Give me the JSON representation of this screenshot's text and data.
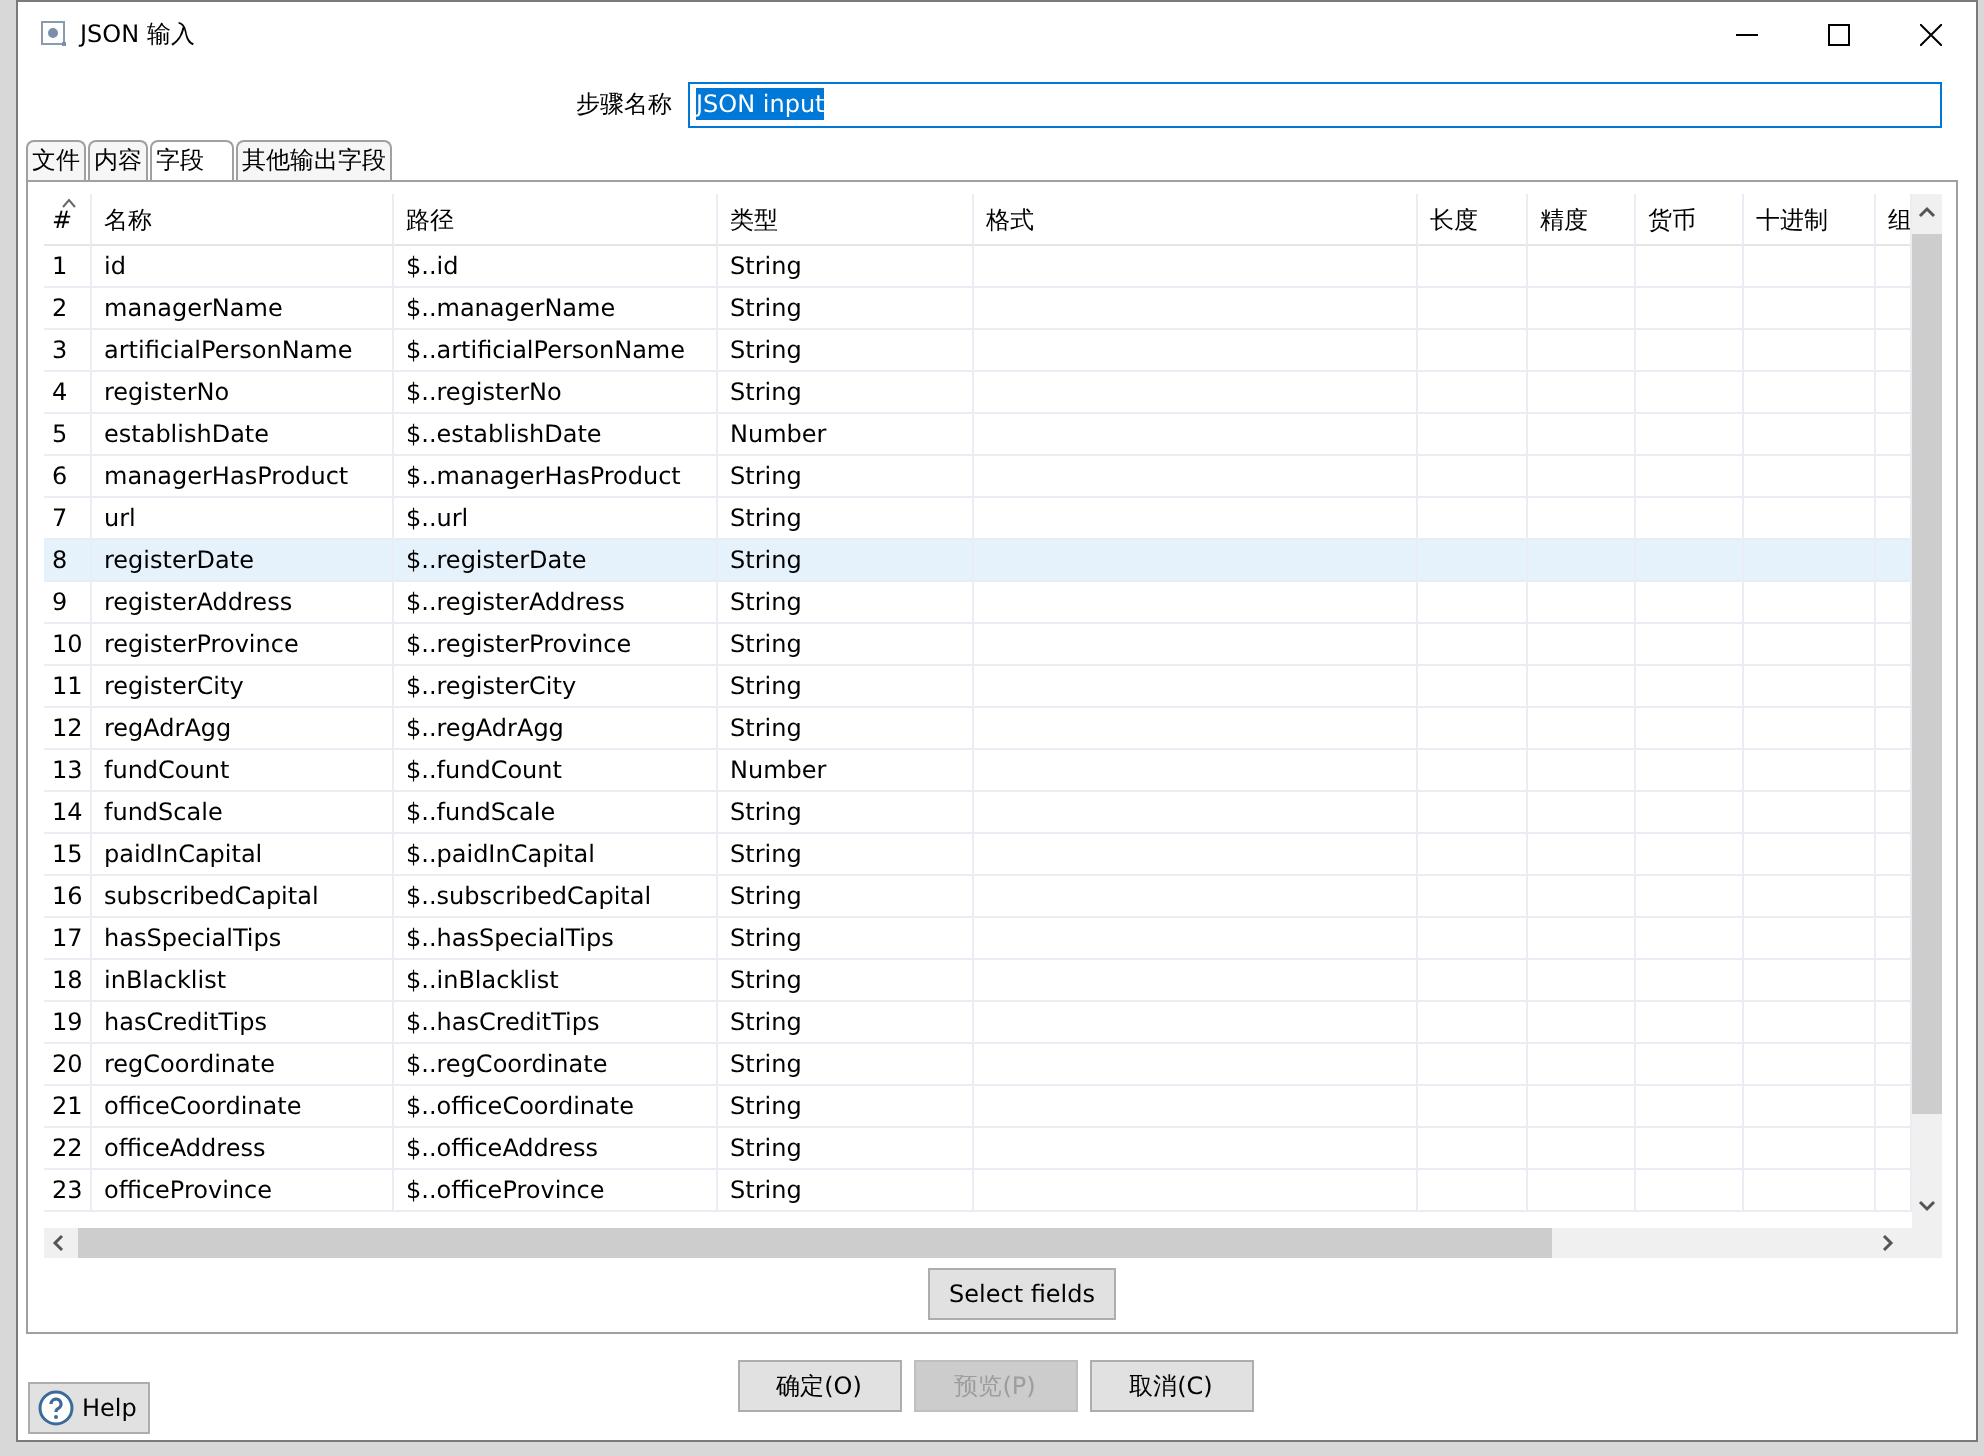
{
  "window": {
    "title": "JSON 输入"
  },
  "step_name": {
    "label": "步骤名称",
    "value": "JSON input"
  },
  "tabs": [
    {
      "label": "文件",
      "selected": false
    },
    {
      "label": "内容",
      "selected": false
    },
    {
      "label": "字段",
      "selected": true
    },
    {
      "label": "其他输出字段",
      "selected": false
    }
  ],
  "table": {
    "columns": [
      "#",
      "名称",
      "路径",
      "类型",
      "格式",
      "长度",
      "精度",
      "货币",
      "十进制",
      "组"
    ],
    "rows": [
      {
        "cells": [
          "1",
          "id",
          "$..id",
          "String"
        ],
        "selected": false
      },
      {
        "cells": [
          "2",
          "managerName",
          "$..managerName",
          "String"
        ],
        "selected": false
      },
      {
        "cells": [
          "3",
          "artificialPersonName",
          "$..artificialPersonName",
          "String"
        ],
        "selected": false
      },
      {
        "cells": [
          "4",
          "registerNo",
          "$..registerNo",
          "String"
        ],
        "selected": false
      },
      {
        "cells": [
          "5",
          "establishDate",
          "$..establishDate",
          "Number"
        ],
        "selected": false
      },
      {
        "cells": [
          "6",
          "managerHasProduct",
          "$..managerHasProduct",
          "String"
        ],
        "selected": false
      },
      {
        "cells": [
          "7",
          "url",
          "$..url",
          "String"
        ],
        "selected": false
      },
      {
        "cells": [
          "8",
          "registerDate",
          "$..registerDate",
          "String"
        ],
        "selected": true
      },
      {
        "cells": [
          "9",
          "registerAddress",
          "$..registerAddress",
          "String"
        ],
        "selected": false
      },
      {
        "cells": [
          "10",
          "registerProvince",
          "$..registerProvince",
          "String"
        ],
        "selected": false
      },
      {
        "cells": [
          "11",
          "registerCity",
          "$..registerCity",
          "String"
        ],
        "selected": false
      },
      {
        "cells": [
          "12",
          "regAdrAgg",
          "$..regAdrAgg",
          "String"
        ],
        "selected": false
      },
      {
        "cells": [
          "13",
          "fundCount",
          "$..fundCount",
          "Number"
        ],
        "selected": false
      },
      {
        "cells": [
          "14",
          "fundScale",
          "$..fundScale",
          "String"
        ],
        "selected": false
      },
      {
        "cells": [
          "15",
          "paidInCapital",
          "$..paidInCapital",
          "String"
        ],
        "selected": false
      },
      {
        "cells": [
          "16",
          "subscribedCapital",
          "$..subscribedCapital",
          "String"
        ],
        "selected": false
      },
      {
        "cells": [
          "17",
          "hasSpecialTips",
          "$..hasSpecialTips",
          "String"
        ],
        "selected": false
      },
      {
        "cells": [
          "18",
          "inBlacklist",
          "$..inBlacklist",
          "String"
        ],
        "selected": false
      },
      {
        "cells": [
          "19",
          "hasCreditTips",
          "$..hasCreditTips",
          "String"
        ],
        "selected": false
      },
      {
        "cells": [
          "20",
          "regCoordinate",
          "$..regCoordinate",
          "String"
        ],
        "selected": false
      },
      {
        "cells": [
          "21",
          "officeCoordinate",
          "$..officeCoordinate",
          "String"
        ],
        "selected": false
      },
      {
        "cells": [
          "22",
          "officeAddress",
          "$..officeAddress",
          "String"
        ],
        "selected": false
      },
      {
        "cells": [
          "23",
          "officeProvince",
          "$..officeProvince",
          "String"
        ],
        "selected": false
      }
    ]
  },
  "select_fields_button": {
    "label": "Select fields"
  },
  "buttons": [
    {
      "label": "确定(O)",
      "disabled": false
    },
    {
      "label": "预览(P)",
      "disabled": true
    },
    {
      "label": "取消(C)",
      "disabled": false
    }
  ],
  "help_button": {
    "label": "Help"
  }
}
